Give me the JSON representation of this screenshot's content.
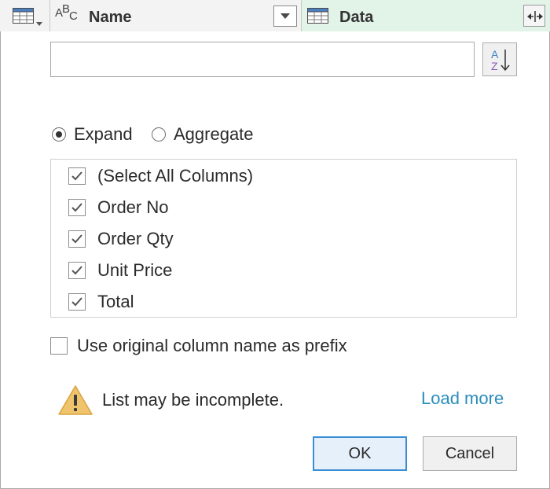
{
  "header": {
    "name_column": {
      "title": "Name",
      "type_glyphs": [
        "A",
        "B",
        "C"
      ]
    },
    "data_column": {
      "title": "Data"
    }
  },
  "dialog": {
    "search": {
      "value": "",
      "placeholder": ""
    },
    "sort_icon_letters": [
      "A",
      "Z"
    ],
    "mode": {
      "selected": "Expand",
      "options": [
        {
          "label": "Expand",
          "selected": true
        },
        {
          "label": "Aggregate",
          "selected": false
        }
      ]
    },
    "columns": [
      {
        "label": "(Select All Columns)",
        "checked": true
      },
      {
        "label": "Order No",
        "checked": true
      },
      {
        "label": "Order Qty",
        "checked": true
      },
      {
        "label": "Unit Price",
        "checked": true
      },
      {
        "label": "Total",
        "checked": true
      }
    ],
    "prefix": {
      "label": "Use original column name as prefix",
      "checked": false
    },
    "warning": {
      "text": "List may be incomplete.",
      "link": "Load more"
    },
    "buttons": {
      "ok": "OK",
      "cancel": "Cancel"
    }
  },
  "colors": {
    "data_header_bg": "#e2f3e8",
    "link": "#2a8dbb",
    "ok_border": "#3c8ed3",
    "warning_fill": "#f0c36d",
    "sort_a": "#3a7fc1",
    "sort_z": "#8b5bb8"
  },
  "icons": [
    "table-icon",
    "text-type-icon",
    "chevron-down-icon",
    "expand-column-icon",
    "sort-az-icon",
    "checkmark-icon",
    "warning-icon"
  ]
}
